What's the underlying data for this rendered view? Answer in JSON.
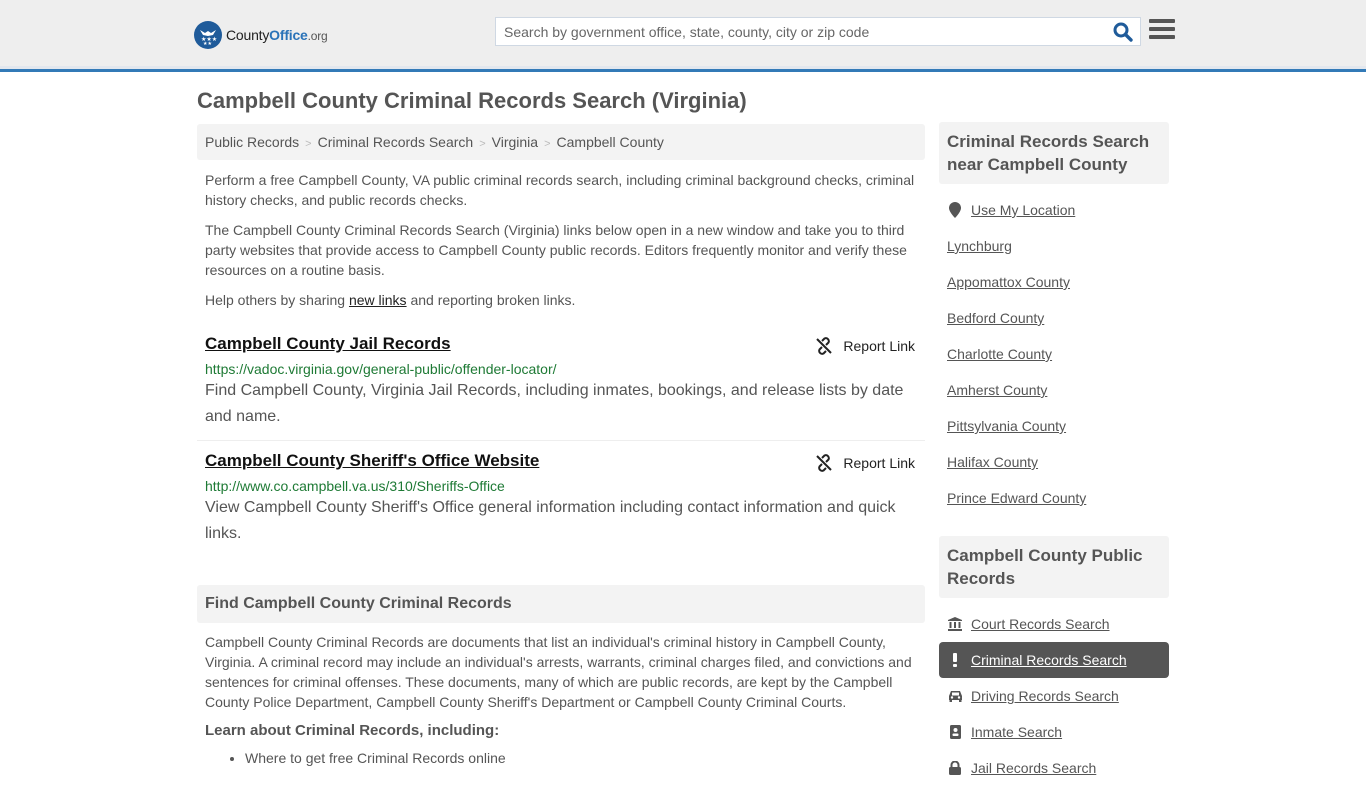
{
  "header": {
    "logo": {
      "brand_part1": "County",
      "brand_part2": "Office",
      "brand_tld": ".org"
    },
    "search": {
      "placeholder": "Search by government office, state, county, city or zip code",
      "value": ""
    },
    "icons": {
      "search": "search-icon",
      "menu": "hamburger-menu-icon"
    }
  },
  "page": {
    "title": "Campbell County Criminal Records Search (Virginia)"
  },
  "breadcrumb": [
    {
      "label": "Public Records"
    },
    {
      "label": "Criminal Records Search"
    },
    {
      "label": "Virginia"
    },
    {
      "label": "Campbell County"
    }
  ],
  "intro": {
    "p1": "Perform a free Campbell County, VA public criminal records search, including criminal background checks, criminal history checks, and public records checks.",
    "p2": "The Campbell County Criminal Records Search (Virginia) links below open in a new window and take you to third party websites that provide access to Campbell County public records. Editors frequently monitor and verify these resources on a routine basis.",
    "p3_before": "Help others by sharing ",
    "p3_link": "new links",
    "p3_after": " and reporting broken links."
  },
  "links": [
    {
      "title": "Campbell County Jail Records",
      "url": "https://vadoc.virginia.gov/general-public/offender-locator/",
      "description": "Find Campbell County, Virginia Jail Records, including inmates, bookings, and release lists by date and name.",
      "report_label": "Report Link"
    },
    {
      "title": "Campbell County Sheriff's Office Website",
      "url": "http://www.co.campbell.va.us/310/Sheriffs-Office",
      "description": "View Campbell County Sheriff's Office general information including contact information and quick links.",
      "report_label": "Report Link"
    }
  ],
  "find_section": {
    "heading": "Find Campbell County Criminal Records",
    "body": "Campbell County Criminal Records are documents that list an individual's criminal history in Campbell County, Virginia. A criminal record may include an individual's arrests, warrants, criminal charges filed, and convictions and sentences for criminal offenses. These documents, many of which are public records, are kept by the Campbell County Police Department, Campbell County Sheriff's Department or Campbell County Criminal Courts.",
    "learn_heading": "Learn about Criminal Records, including:",
    "bullets": [
      "Where to get free Criminal Records online"
    ]
  },
  "sidebar": {
    "nearby": {
      "heading": "Criminal Records Search near Campbell County",
      "use_location": "Use My Location",
      "places": [
        "Lynchburg",
        "Appomattox County",
        "Bedford County",
        "Charlotte County",
        "Amherst County",
        "Pittsylvania County",
        "Halifax County",
        "Prince Edward County"
      ]
    },
    "public_records": {
      "heading": "Campbell County Public Records",
      "items": [
        {
          "label": "Court Records Search",
          "icon": "courthouse-icon",
          "active": false
        },
        {
          "label": "Criminal Records Search",
          "icon": "exclamation-icon",
          "active": true
        },
        {
          "label": "Driving Records Search",
          "icon": "car-icon",
          "active": false
        },
        {
          "label": "Inmate Search",
          "icon": "id-badge-icon",
          "active": false
        },
        {
          "label": "Jail Records Search",
          "icon": "lock-icon",
          "active": false
        }
      ]
    }
  },
  "colors": {
    "accent_blue": "#337ab7",
    "url_green": "#1e7a35",
    "active_item_bg": "#555555",
    "panel_bg": "#f3f3f3"
  }
}
